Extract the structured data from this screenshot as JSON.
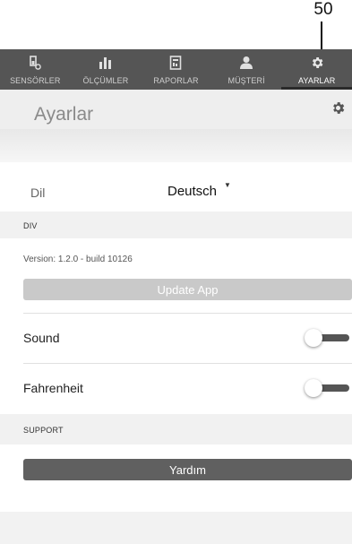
{
  "callout": {
    "number": "50"
  },
  "nav": {
    "items": [
      {
        "label": "SENSÖRLER",
        "icon": "sensor-icon"
      },
      {
        "label": "ÖLÇÜMLER",
        "icon": "bar-chart-icon"
      },
      {
        "label": "RAPORLAR",
        "icon": "report-icon"
      },
      {
        "label": "MÜŞTERİ",
        "icon": "person-icon"
      },
      {
        "label": "AYARLAR",
        "icon": "gear-icon",
        "active": true
      }
    ]
  },
  "header": {
    "title": "Ayarlar",
    "icon": "gear-icon"
  },
  "language": {
    "label": "Dil",
    "value": "Deutsch"
  },
  "sections": {
    "div": "DIV",
    "support": "SUPPORT"
  },
  "version": {
    "text": "Version: 1.2.0 - build 10126"
  },
  "buttons": {
    "update": "Update App",
    "help": "Yardım"
  },
  "toggles": [
    {
      "label": "Sound",
      "on": false
    },
    {
      "label": "Fahrenheit",
      "on": false
    }
  ],
  "colors": {
    "navbar": "#555555",
    "active_underline": "#2a2a2a",
    "help_button": "#606060",
    "update_button": "#c9c9c9"
  }
}
